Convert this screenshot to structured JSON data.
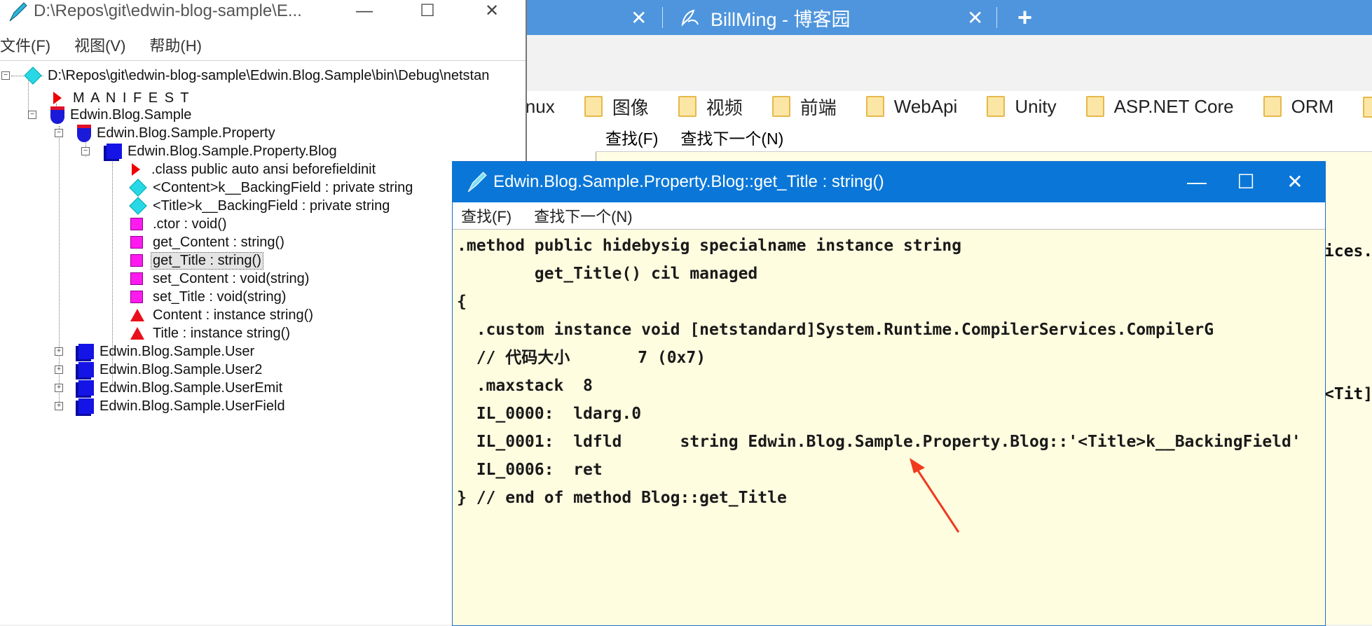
{
  "browser": {
    "tabs": [
      {
        "label": "",
        "close": "✕"
      },
      {
        "label": "BillMing - 博客园",
        "close": "✕"
      }
    ],
    "new_tab": "+",
    "bookmarks": [
      "inux",
      "图像",
      "视频",
      "前端",
      "WebApi",
      "Unity",
      "ASP.NET Core",
      "ORM"
    ],
    "background_find_menu": [
      "查找(F)",
      "查找下一个(N)"
    ],
    "background_code_fragments": [
      "ices.",
      "<Tit]"
    ]
  },
  "ildasm": {
    "title": "D:\\Repos\\git\\edwin-blog-sample\\E...",
    "window_controls": {
      "minimize": "—",
      "maximize": "☐",
      "close": "✕"
    },
    "menu": [
      "文件(F)",
      "视图(V)",
      "帮助(H)"
    ],
    "tree": {
      "root": "D:\\Repos\\git\\edwin-blog-sample\\Edwin.Blog.Sample\\bin\\Debug\\netstan",
      "manifest": "M A N I F E S T",
      "assembly": "Edwin.Blog.Sample",
      "namespace": "Edwin.Blog.Sample.Property",
      "class": "Edwin.Blog.Sample.Property.Blog",
      "members": [
        {
          "label": ".class public auto ansi beforefieldinit",
          "icon": "red-flag-icon"
        },
        {
          "label": "<Content>k__BackingField : private string",
          "icon": "field-diamond-icon"
        },
        {
          "label": "<Title>k__BackingField : private string",
          "icon": "field-diamond-icon"
        },
        {
          "label": ".ctor : void()",
          "icon": "method-icon"
        },
        {
          "label": "get_Content : string()",
          "icon": "method-icon"
        },
        {
          "label": "get_Title : string()",
          "icon": "method-icon",
          "selected": true
        },
        {
          "label": "set_Content : void(string)",
          "icon": "method-icon"
        },
        {
          "label": "set_Title : void(string)",
          "icon": "method-icon"
        },
        {
          "label": "Content : instance string()",
          "icon": "property-triangle-icon"
        },
        {
          "label": "Title : instance string()",
          "icon": "property-triangle-icon"
        }
      ],
      "other_classes": [
        "Edwin.Blog.Sample.User",
        "Edwin.Blog.Sample.User2",
        "Edwin.Blog.Sample.UserEmit",
        "Edwin.Blog.Sample.UserField"
      ]
    }
  },
  "method_window": {
    "title": "Edwin.Blog.Sample.Property.Blog::get_Title : string()",
    "window_controls": {
      "minimize": "—",
      "maximize": "☐",
      "close": "✕"
    },
    "menu": [
      "查找(F)",
      "查找下一个(N)"
    ],
    "code_lines": [
      ".method public hidebysig specialname instance string",
      "        get_Title() cil managed",
      "{",
      "  .custom instance void [netstandard]System.Runtime.CompilerServices.CompilerG",
      "  // 代码大小       7 (0x7)",
      "  .maxstack  8",
      "  IL_0000:  ldarg.0",
      "  IL_0001:  ldfld      string Edwin.Blog.Sample.Property.Blog::'<Title>k__BackingField'",
      "  IL_0006:  ret",
      "} // end of method Blog::get_Title"
    ]
  },
  "colors": {
    "browser_tabbar": "#4e95dd",
    "method_titlebar": "#0a77d8",
    "code_background": "#fffde0",
    "annotation_arrow": "#f03a1e"
  }
}
